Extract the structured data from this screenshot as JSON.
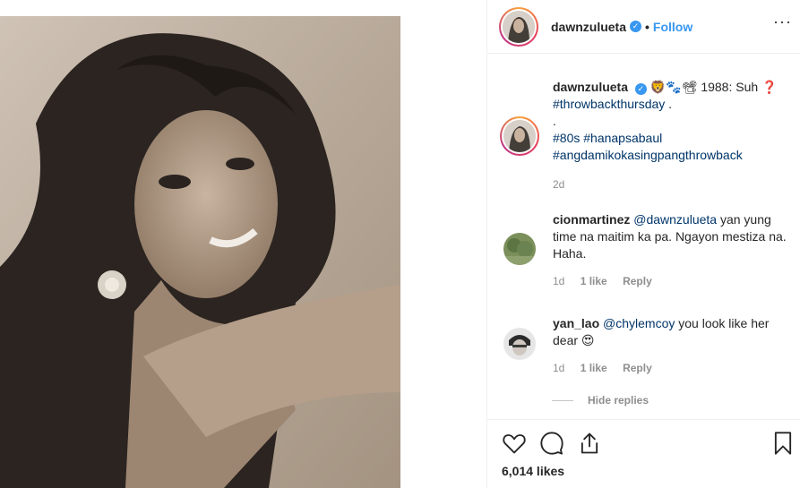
{
  "post": {
    "username": "dawnzulueta",
    "verified_mark": "✓",
    "separator": "•",
    "follow_label": "Follow",
    "more_label": "···"
  },
  "caption": {
    "username": "dawnzulueta",
    "emoji": "🦁🐾📽",
    "text": " 1988: Suh ",
    "question_mark": "❓",
    "tag1": "#throwbackthursday",
    "dot1": " .",
    "dot2": ".",
    "tag2": "#80s",
    "tag3": "#hanapsabaul",
    "tag4": "#angdamikokasingpangthrowback",
    "time": "2d"
  },
  "comments": [
    {
      "username": "cionmartinez",
      "mention": "@dawnzulueta",
      "text": " yan yung time na maitim ka pa. Ngayon mestiza na. Haha.",
      "time": "1d",
      "likes": "1 like",
      "reply": "Reply"
    },
    {
      "username": "yan_lao",
      "mention": "@chylemcoy",
      "text": " you look like her dear ",
      "emoji": "😍",
      "time": "1d",
      "likes": "1 like",
      "reply": "Reply"
    }
  ],
  "hide_replies_label": "Hide replies",
  "likes_count": "6,014 likes",
  "icons": {
    "like": "heart-icon",
    "comment": "comment-icon",
    "share": "share-icon",
    "save": "bookmark-icon"
  },
  "colors": {
    "link": "#003569",
    "follow": "#3897f0",
    "muted": "#8e8e8e"
  }
}
